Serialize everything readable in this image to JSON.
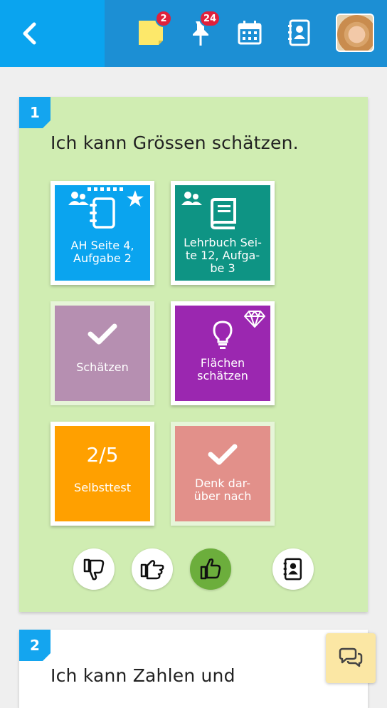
{
  "header": {
    "notes_badge": "2",
    "pins_badge": "24"
  },
  "cards": [
    {
      "number": "1",
      "title": "Ich kann Grössen schätzen.",
      "tiles": [
        {
          "label": "AH Seite 4, Aufgabe 2",
          "color": "#0aa4ef"
        },
        {
          "label": "Lehrbuch Seite 12, Aufgabe 3",
          "label_line1": "Lehrbuch Sei-",
          "label_line2": "te 12, Aufga-",
          "label_line3": "be 3",
          "color": "#0e9484"
        },
        {
          "label": "Schätzen",
          "color": "#b68fb1"
        },
        {
          "label_line1": "Flächen",
          "label_line2": "schätzen",
          "color": "#9b27b0"
        },
        {
          "value": "2/5",
          "label": "Selbsttest",
          "color": "#ffa000"
        },
        {
          "label_line1": "Denk dar-",
          "label_line2": "über nach",
          "color": "#e2908a"
        }
      ]
    },
    {
      "number": "2",
      "title": "Ich kann Zahlen und"
    }
  ],
  "tile1": {
    "line1": "AH Seite 4,",
    "line2": "Aufgabe 2"
  }
}
